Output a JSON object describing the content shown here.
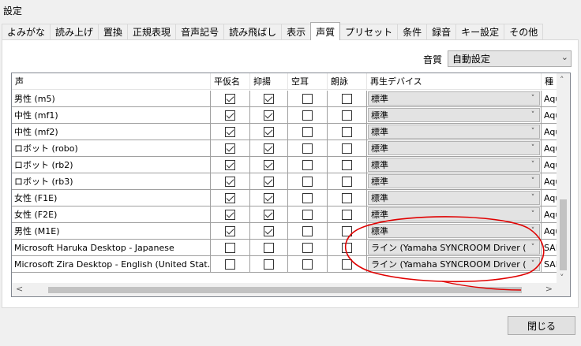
{
  "window": {
    "title": "設定"
  },
  "tabs": [
    "よみがな",
    "読み上げ",
    "置換",
    "正規表現",
    "音声記号",
    "読み飛ばし",
    "表示",
    "声質",
    "プリセット",
    "条件",
    "録音",
    "キー設定",
    "その他"
  ],
  "active_tab": 7,
  "quality": {
    "label": "音質",
    "value": "自動設定"
  },
  "columns": [
    "声",
    "平仮名",
    "抑揚",
    "空耳",
    "朗詠",
    "再生デバイス",
    "種"
  ],
  "rows": [
    {
      "name": "男性 (m5)",
      "hiragana": true,
      "intonation": true,
      "soramimi": false,
      "roei": false,
      "device": "標準",
      "kind": "Aqu"
    },
    {
      "name": "中性 (mf1)",
      "hiragana": true,
      "intonation": true,
      "soramimi": false,
      "roei": false,
      "device": "標準",
      "kind": "Aqu"
    },
    {
      "name": "中性 (mf2)",
      "hiragana": true,
      "intonation": true,
      "soramimi": false,
      "roei": false,
      "device": "標準",
      "kind": "Aqu"
    },
    {
      "name": "ロボット (robo)",
      "hiragana": true,
      "intonation": true,
      "soramimi": false,
      "roei": false,
      "device": "標準",
      "kind": "Aqu"
    },
    {
      "name": "ロボット (rb2)",
      "hiragana": true,
      "intonation": true,
      "soramimi": false,
      "roei": false,
      "device": "標準",
      "kind": "Aqu"
    },
    {
      "name": "ロボット (rb3)",
      "hiragana": true,
      "intonation": true,
      "soramimi": false,
      "roei": false,
      "device": "標準",
      "kind": "Aqu"
    },
    {
      "name": "女性 (F1E)",
      "hiragana": true,
      "intonation": true,
      "soramimi": false,
      "roei": false,
      "device": "標準",
      "kind": "Aqu"
    },
    {
      "name": "女性 (F2E)",
      "hiragana": true,
      "intonation": true,
      "soramimi": false,
      "roei": false,
      "device": "標準",
      "kind": "Aqu"
    },
    {
      "name": "男性 (M1E)",
      "hiragana": true,
      "intonation": true,
      "soramimi": false,
      "roei": false,
      "device": "標準",
      "kind": "Aqu"
    },
    {
      "name": "Microsoft Haruka Desktop - Japanese",
      "hiragana": false,
      "intonation": false,
      "soramimi": false,
      "roei": false,
      "device": "ライン (Yamaha SYNCROOM Driver (WI",
      "kind": "SAF"
    },
    {
      "name": "Microsoft Zira Desktop - English (United Stat...",
      "hiragana": false,
      "intonation": false,
      "soramimi": false,
      "roei": false,
      "device": "ライン (Yamaha SYNCROOM Driver (...",
      "kind": "SAF"
    }
  ],
  "buttons": {
    "close": "閉じる"
  },
  "colors": {
    "annotation": "#e00000"
  }
}
